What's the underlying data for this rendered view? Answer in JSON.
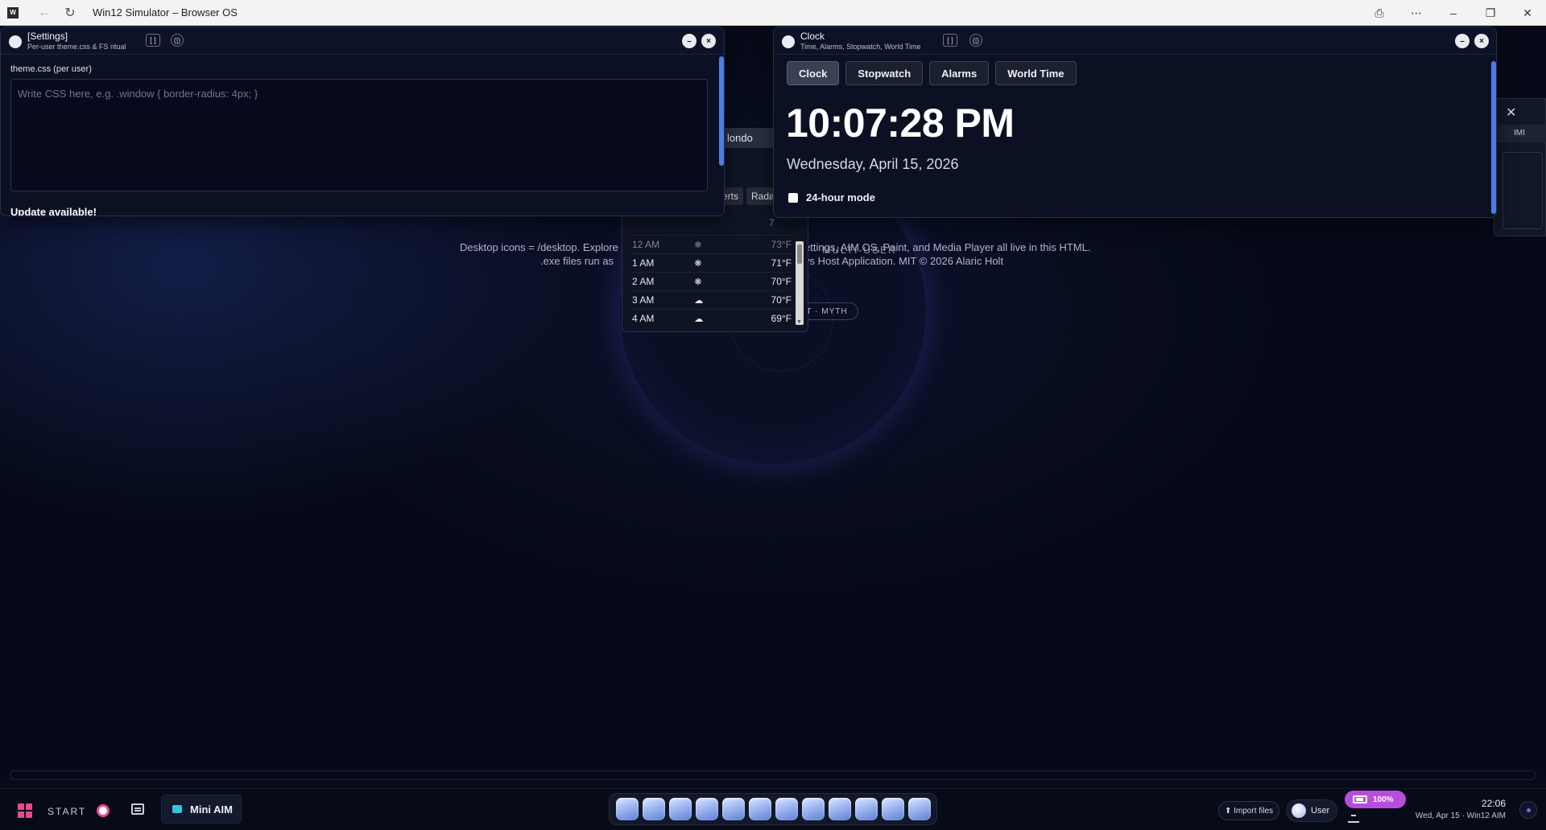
{
  "browser": {
    "favicon_letter": "W",
    "title": "Win12 Simulator – Browser OS",
    "icons": [
      "back-arrow-icon",
      "refresh-icon",
      "cast-icon",
      "more-icon",
      "minimize-icon",
      "restore-icon",
      "close-icon"
    ]
  },
  "desktop": {
    "tag": "· MULTI-USER",
    "about_line1_left": "Desktop icons = /desktop. Explore",
    "about_line1_right": "ettings, AIM OS, Paint, and Media Player all live in this HTML.",
    "about_line2_left": ".exe files run as",
    "about_line2_right": "ys Host Application. MIT © 2026 Alaric Holt",
    "pill": "T · MYTH"
  },
  "weather": {
    "location_fragment": "londo",
    "tabs": [
      "erts",
      "Radar"
    ],
    "hourly": [
      {
        "time": "12 AM",
        "icon": "sun-icon",
        "temp": "73°F"
      },
      {
        "time": "1 AM",
        "icon": "sun-icon",
        "temp": "71°F"
      },
      {
        "time": "2 AM",
        "icon": "sun-icon",
        "temp": "70°F"
      },
      {
        "time": "3 AM",
        "icon": "cloud-icon",
        "temp": "70°F"
      },
      {
        "time": "4 AM",
        "icon": "cloud-icon",
        "temp": "69°F"
      }
    ],
    "top_fragment": "7"
  },
  "side_panel": {
    "close": "✕",
    "bar_text": "IMI"
  },
  "settings_window": {
    "title": "[Settings]",
    "subtitle": "Per-user theme.css & FS ritual",
    "field_label": "theme.css (per user)",
    "placeholder": "Write CSS here, e.g. .window { border-radius: 4px; }",
    "update_text": "Update available!",
    "btn_code": "[ ]",
    "btn_audio": "(|)",
    "min": "–",
    "close": "×"
  },
  "clock_window": {
    "title": "Clock",
    "subtitle": "Time, Alarms, Stopwatch, World Time",
    "btn_code": "[ ]",
    "btn_audio": "(|)",
    "min": "–",
    "close": "×",
    "tabs": [
      "Clock",
      "Stopwatch",
      "Alarms",
      "World Time"
    ],
    "active_tab": "Clock",
    "time": "10:07:28 PM",
    "date": "Wednesday, April 15, 2026",
    "toggle_label": "24-hour mode",
    "toggle_checked": false
  },
  "taskbar": {
    "start_label": "START",
    "task": "Mini AIM",
    "dock_app_count": 12,
    "import_label": "⬆ Import files",
    "user_label": "User",
    "battery": "100%",
    "time": "22:06",
    "date": "Wed, Apr 15 · Win12 AIM"
  }
}
